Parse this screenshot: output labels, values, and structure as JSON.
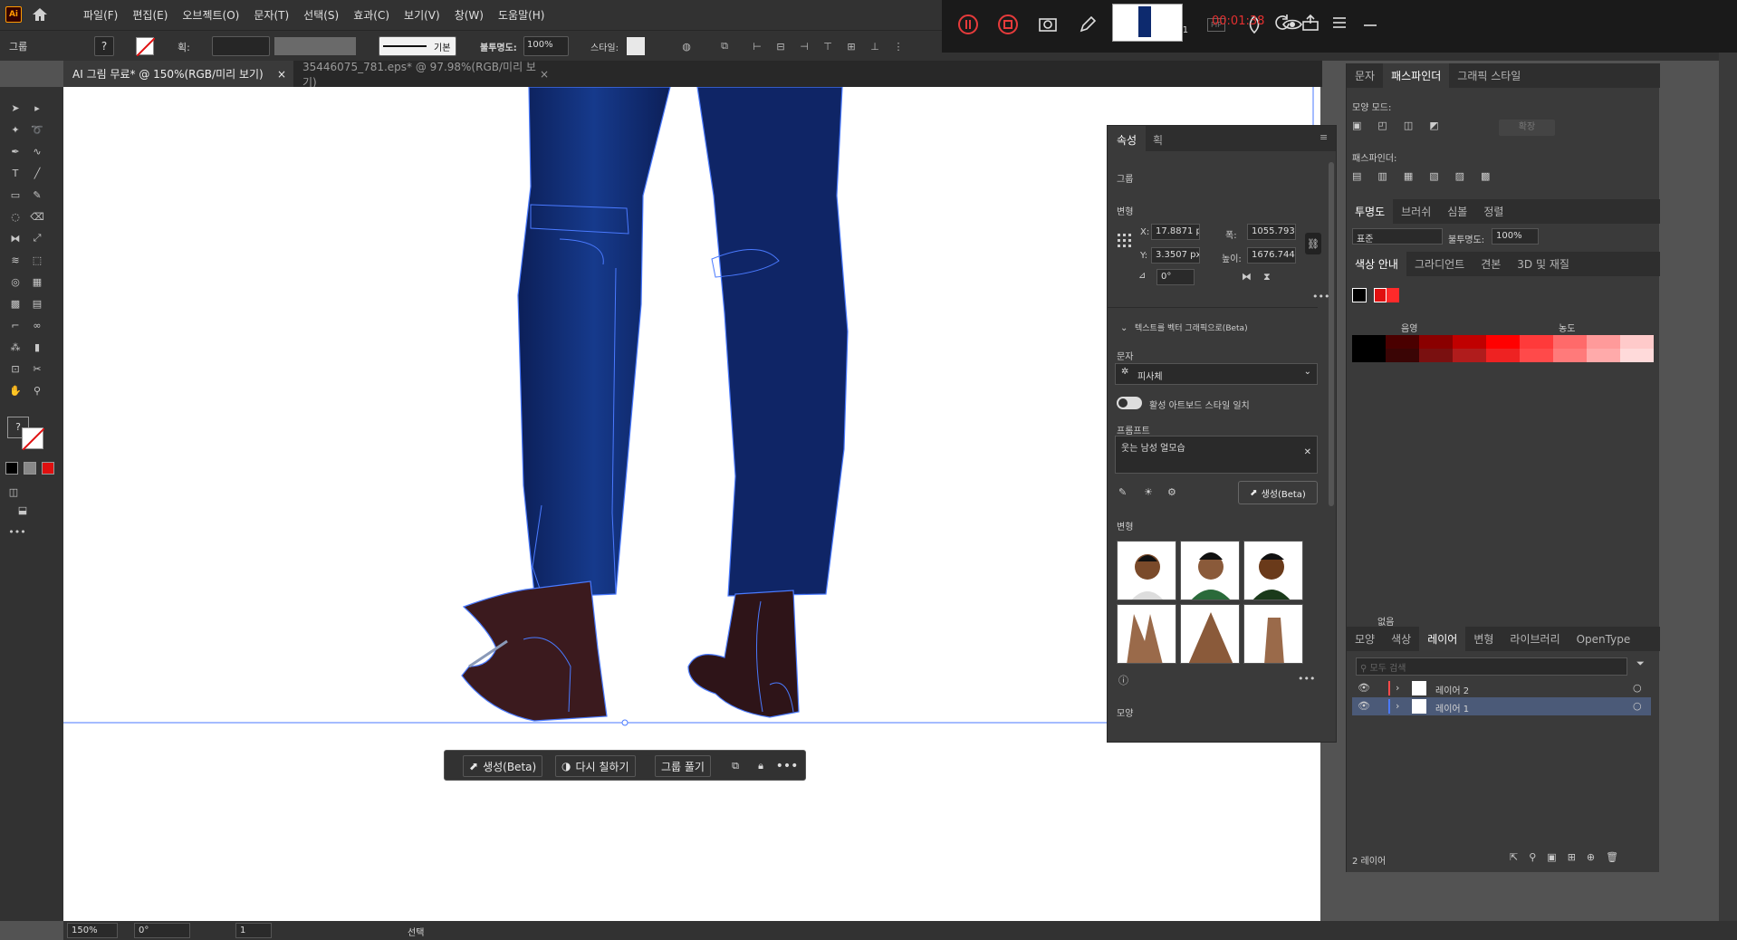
{
  "app": {
    "logo": "Ai",
    "home_icon": "home-icon"
  },
  "menu": [
    "파일(F)",
    "편집(E)",
    "오브젝트(O)",
    "문자(T)",
    "선택(S)",
    "효과(C)",
    "보기(V)",
    "창(W)",
    "도움말(H)"
  ],
  "control": {
    "selection_label": "그룹",
    "stroke_label": "획:",
    "stroke_style": "기본",
    "opacity_label": "불투명도:",
    "opacity_value": "100%",
    "style_label": "스타일:"
  },
  "tabs": [
    {
      "label": "AI 그림 무료* @ 150%(RGB/미리 보기)",
      "close": "×"
    },
    {
      "label": "35446075_781.eps* @ 97.98%(RGB/미리 보기)",
      "close": "×"
    }
  ],
  "recorder": {
    "time": "00:01:38",
    "speed": "x1",
    "pip": "PIP"
  },
  "props": {
    "tabs": [
      "속성",
      "획"
    ],
    "group_label": "그룹",
    "transform_label": "변형",
    "x_label": "X:",
    "x_value": "17.8871 p",
    "y_label": "Y:",
    "y_value": "3.3507 px",
    "w_label": "폭:",
    "w_value": "1055.7933",
    "h_label": "높이:",
    "h_value": "1676.744'",
    "angle_value": "0°",
    "text_to_vector": "텍스트를 벡터 그래픽으로(Beta)",
    "type_label": "문자",
    "type_value": "피사체",
    "toggle_label": "활성 아트보드 스타일 일치",
    "prompt_label": "프롬프트",
    "prompt_value": "웃는 남성 얼모습",
    "generate_label": "생성(Beta)",
    "variations_label": "변형",
    "appearance_label": "모양"
  },
  "pathfinder": {
    "tabs": [
      "문자",
      "패스파인더",
      "그래픽 스타일"
    ],
    "shape_modes": "모양 모드:",
    "expand": "확장",
    "pathfinders": "패스파인더:"
  },
  "transparency": {
    "tabs": [
      "투명도",
      "브러쉬",
      "심볼",
      "정렬"
    ],
    "mode": "표준",
    "opacity_label": "불투명도:",
    "opacity_value": "100%"
  },
  "color_guide": {
    "tabs": [
      "색상 안내",
      "그라디언트",
      "견본",
      "3D 및 재질"
    ],
    "shades_label": "음영",
    "tints_label": "농도",
    "none_label": "없음",
    "row1": [
      "#000000",
      "#4a0000",
      "#8a0000",
      "#c00000",
      "#ff0000",
      "#ff3a3a",
      "#ff6a6a",
      "#ff9a9a",
      "#ffcaca"
    ],
    "row2": [
      "#000000",
      "#3a0505",
      "#7a1010",
      "#b01c1c",
      "#ee2222",
      "#ff4a4a",
      "#ff7a7a",
      "#ffaaaa",
      "#ffdada"
    ]
  },
  "layers": {
    "tabs": [
      "모양",
      "색상",
      "레이어",
      "변형",
      "라이브러리",
      "OpenType"
    ],
    "search_placeholder": "모두 검색",
    "items": [
      {
        "name": "레이어 2",
        "color": "#ff4a4a"
      },
      {
        "name": "레이어 1",
        "color": "#4a7aff"
      }
    ],
    "count": "2 레이어"
  },
  "floating": {
    "generate": "생성(Beta)",
    "recolor": "다시 칠하기",
    "ungroup": "그룹 풀기"
  },
  "status": {
    "zoom": "150%",
    "angle": "0°",
    "artboard": "1",
    "tool": "선택"
  }
}
